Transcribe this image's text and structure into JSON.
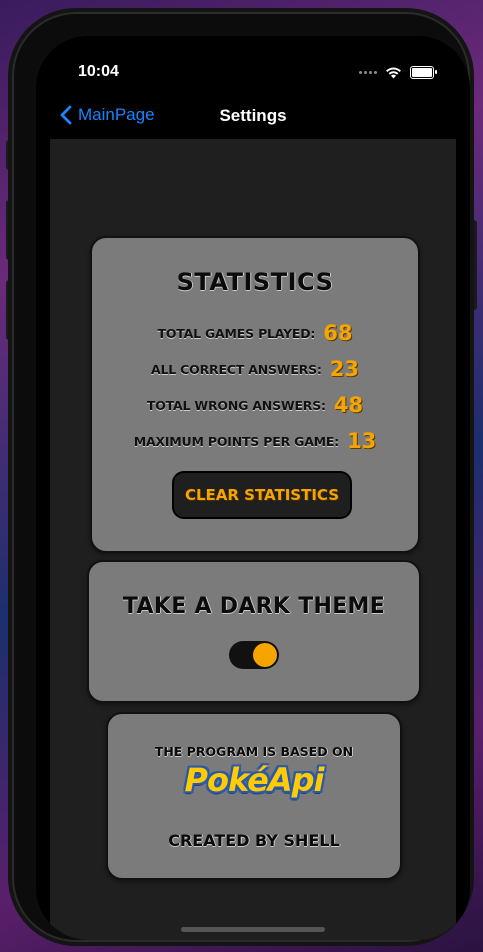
{
  "status_bar": {
    "time": "10:04"
  },
  "nav": {
    "back_label": "MainPage",
    "title": "Settings"
  },
  "statistics": {
    "title": "STATISTICS",
    "rows": [
      {
        "label": "TOTAL GAMES PLAYED:",
        "value": "68"
      },
      {
        "label": "ALL CORRECT ANSWERS:",
        "value": "23"
      },
      {
        "label": "TOTAL WRONG ANSWERS:",
        "value": "48"
      },
      {
        "label": "MAXIMUM POINTS PER GAME:",
        "value": "13"
      }
    ],
    "clear_button": "CLEAR STATISTICS"
  },
  "theme": {
    "title": "TAKE A DARK THEME",
    "dark_theme_on": true
  },
  "about": {
    "based_on": "THE PROGRAM IS BASED ON",
    "logo_text": "PokéApi",
    "created_by": "CREATED BY SHELL"
  },
  "colors": {
    "accent": "#f5a400",
    "link": "#1a84ff",
    "card": "#7b7b7b",
    "background": "#1f1f1f"
  }
}
